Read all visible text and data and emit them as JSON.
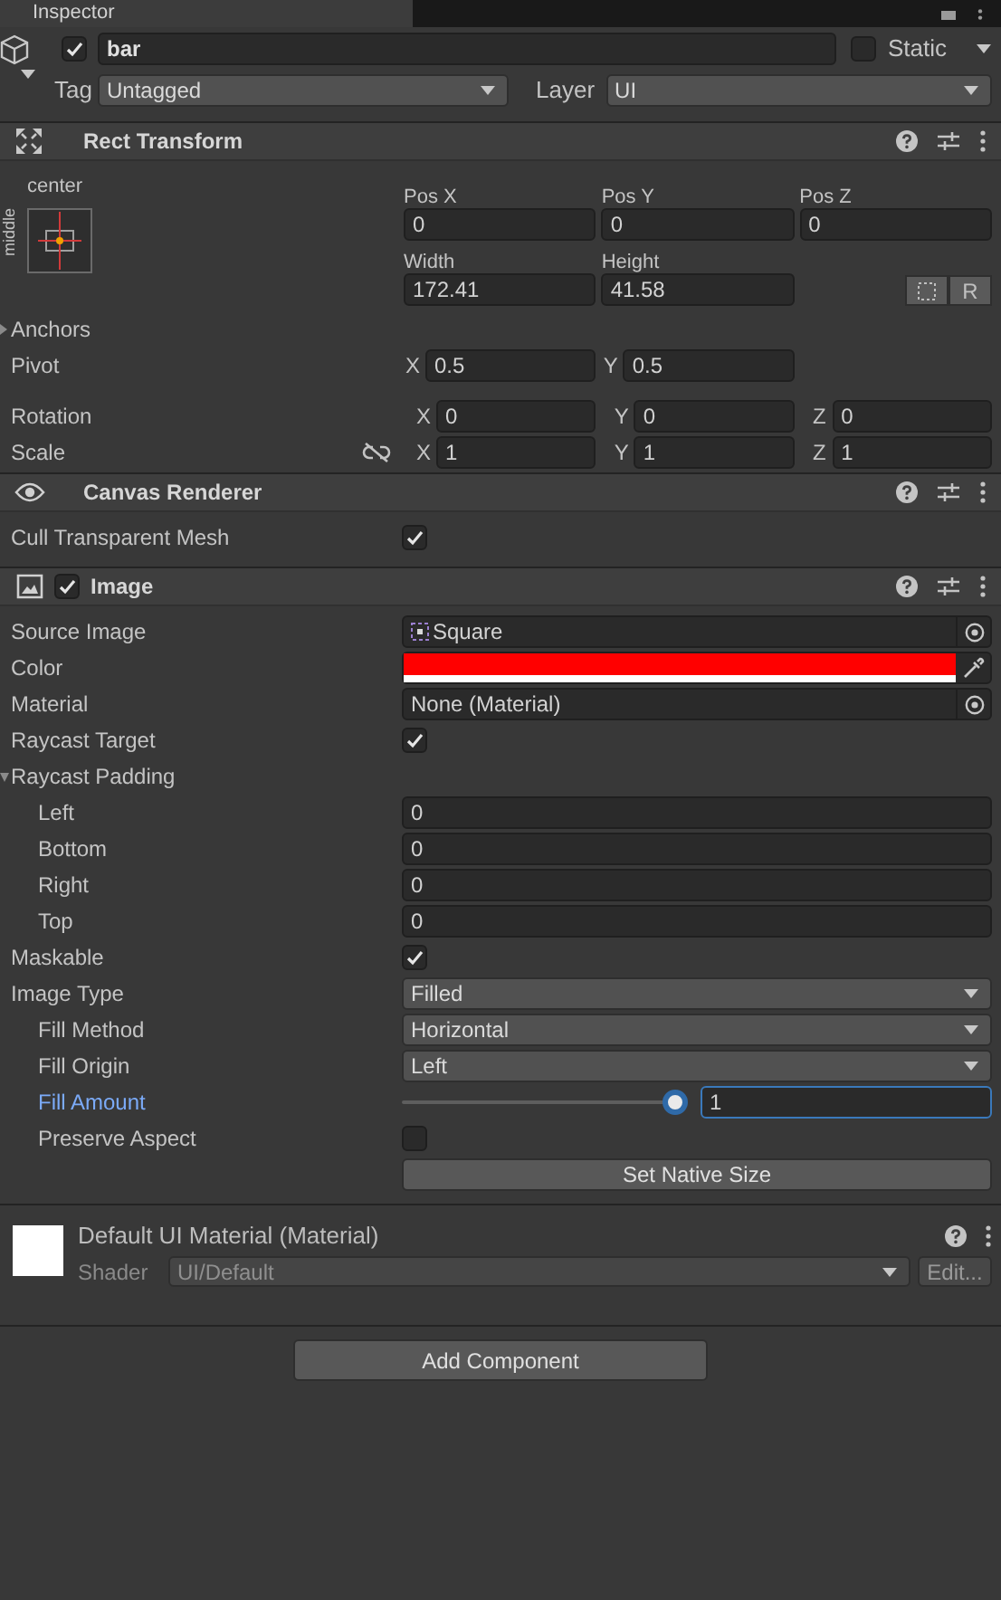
{
  "tab": {
    "label": "Inspector"
  },
  "object": {
    "active": true,
    "name": "bar",
    "static": false,
    "static_label": "Static",
    "tag_label": "Tag",
    "tag": "Untagged",
    "layer_label": "Layer",
    "layer": "UI"
  },
  "components": [
    {
      "kind": "rect_transform",
      "title": "Rect Transform",
      "preset_label": "center",
      "preset_side_label": "middle",
      "position": [
        {
          "label": "Pos X",
          "value": "0"
        },
        {
          "label": "Pos Y",
          "value": "0"
        },
        {
          "label": "Pos Z",
          "value": "0"
        }
      ],
      "size": [
        {
          "label": "Width",
          "value": "172.41"
        },
        {
          "label": "Height",
          "value": "41.58"
        }
      ],
      "raw_edit_label": "R",
      "anchors": {
        "label": "Anchors",
        "expanded": false
      },
      "pivot": {
        "label": "Pivot",
        "fields": [
          {
            "axis": "X",
            "value": "0.5"
          },
          {
            "axis": "Y",
            "value": "0.5"
          }
        ]
      },
      "rotation": {
        "label": "Rotation",
        "fields": [
          {
            "axis": "X",
            "value": "0"
          },
          {
            "axis": "Y",
            "value": "0"
          },
          {
            "axis": "Z",
            "value": "0"
          }
        ]
      },
      "scale": {
        "label": "Scale",
        "fields": [
          {
            "axis": "X",
            "value": "1"
          },
          {
            "axis": "Y",
            "value": "1"
          },
          {
            "axis": "Z",
            "value": "1"
          }
        ]
      }
    },
    {
      "kind": "canvas_renderer",
      "title": "Canvas Renderer",
      "rows": [
        {
          "kind": "checkbox",
          "label": "Cull Transparent Mesh",
          "checked": true
        }
      ]
    },
    {
      "kind": "image",
      "title": "Image",
      "enabled": true,
      "rows": [
        {
          "kind": "object",
          "label": "Source Image",
          "value": "Square",
          "sprite": true
        },
        {
          "kind": "color",
          "label": "Color",
          "color": "#ff0000"
        },
        {
          "kind": "object",
          "label": "Material",
          "value": "None (Material)",
          "sprite": false
        },
        {
          "kind": "checkbox",
          "label": "Raycast Target",
          "checked": true
        },
        {
          "kind": "foldout",
          "label": "Raycast Padding",
          "expanded": true,
          "children": [
            {
              "kind": "text",
              "label": "Left",
              "value": "0"
            },
            {
              "kind": "text",
              "label": "Bottom",
              "value": "0"
            },
            {
              "kind": "text",
              "label": "Right",
              "value": "0"
            },
            {
              "kind": "text",
              "label": "Top",
              "value": "0"
            }
          ]
        },
        {
          "kind": "checkbox",
          "label": "Maskable",
          "checked": true
        },
        {
          "kind": "dropdown",
          "label": "Image Type",
          "value": "Filled",
          "children": [
            {
              "kind": "dropdown",
              "label": "Fill Method",
              "value": "Horizontal"
            },
            {
              "kind": "dropdown",
              "label": "Fill Origin",
              "value": "Left"
            },
            {
              "kind": "slider",
              "label": "Fill Amount",
              "level": 1,
              "value": "1",
              "focused": true
            },
            {
              "kind": "checkbox",
              "label": "Preserve Aspect",
              "checked": false
            }
          ]
        },
        {
          "kind": "button",
          "label": "Set Native Size"
        }
      ]
    },
    {
      "kind": "material",
      "title": "Default UI Material (Material)",
      "shader_label": "Shader",
      "shader": "UI/Default",
      "edit_label": "Edit..."
    }
  ],
  "add_component": "Add Component"
}
